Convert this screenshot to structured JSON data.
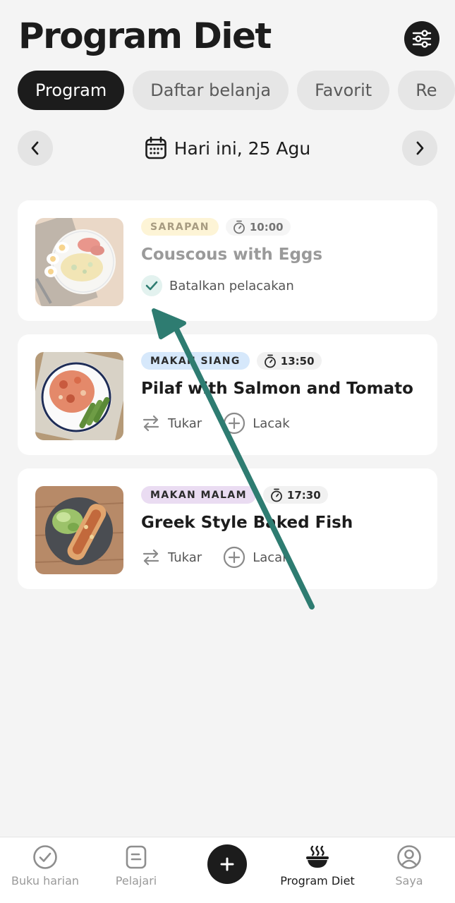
{
  "header": {
    "title": "Program Diet",
    "filter_icon": "sliders-icon"
  },
  "tabs": [
    {
      "label": "Program",
      "active": true
    },
    {
      "label": "Daftar belanja",
      "active": false
    },
    {
      "label": "Favorit",
      "active": false
    },
    {
      "label": "Re",
      "active": false
    }
  ],
  "date_nav": {
    "label": "Hari ini, 25 Agu",
    "prev_icon": "chevron-left-icon",
    "next_icon": "chevron-right-icon",
    "calendar_icon": "calendar-icon"
  },
  "meals": [
    {
      "tag": "SARAPAN",
      "tag_bg": "#fdf1c9",
      "tag_color": "#8a7a58",
      "time": "10:00",
      "name": "Couscous with Eggs",
      "tracked": true,
      "untrack_label": "Batalkan pelacakan"
    },
    {
      "tag": "MAKAN SIANG",
      "tag_bg": "#d6e8fb",
      "tag_color": "#2b2b2b",
      "time": "13:50",
      "name": "Pilaf with Salmon and Tomato",
      "tracked": false,
      "swap_label": "Tukar",
      "track_label": "Lacak"
    },
    {
      "tag": "MAKAN MALAM",
      "tag_bg": "#eadcf2",
      "tag_color": "#2b2b2b",
      "time": "17:30",
      "name": "Greek Style Baked Fish",
      "tracked": false,
      "swap_label": "Tukar",
      "track_label": "Lacak"
    }
  ],
  "bottom_nav": [
    {
      "label": "Buku harian",
      "icon": "check-circle-icon",
      "active": false
    },
    {
      "label": "Pelajari",
      "icon": "document-icon",
      "active": false
    },
    {
      "label": "",
      "icon": "plus-icon",
      "active": false
    },
    {
      "label": "Program Diet",
      "icon": "bowl-icon",
      "active": true
    },
    {
      "label": "Saya",
      "icon": "profile-icon",
      "active": false
    }
  ],
  "colors": {
    "accent": "#2f7d72",
    "annotation_arrow": "#2e7c71",
    "dark": "#1c1c1c",
    "background": "#f4f4f4"
  }
}
